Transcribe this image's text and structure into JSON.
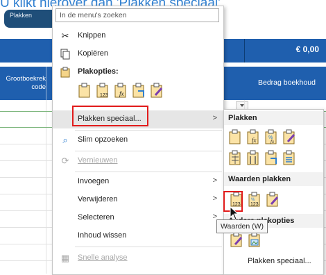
{
  "caption": "U klikt hierover dan 'Plakken speciaal'",
  "pill_label": "Plakken",
  "sheet": {
    "amount": "€ 0,00",
    "header_left": "Grootboekrek code",
    "header_right": "Bedrag boekhoud"
  },
  "search": {
    "placeholder": "In de menu's zoeken"
  },
  "menu": {
    "cut": "Knippen",
    "copy": "Kopiëren",
    "paste_options": "Plakopties:",
    "paste_special": "Plakken speciaal...",
    "smart_lookup": "Slim opzoeken",
    "refresh": "Vernieuwen",
    "insert": "Invoegen",
    "delete": "Verwijderen",
    "select": "Selecteren",
    "clear_contents": "Inhoud wissen",
    "quick_analysis": "Snelle analyse"
  },
  "submenu": {
    "paste_heading": "Plakken",
    "paste_values_heading": "Waarden plakken",
    "other_options_heading": "Andere plakopties",
    "paste_special": "Plakken speciaal...",
    "tooltip": "Waarden (W)"
  },
  "colors": {
    "accent_blue": "#1f5fae",
    "highlight_red": "#e11b1b",
    "caption_blue": "#2f7fd0"
  }
}
